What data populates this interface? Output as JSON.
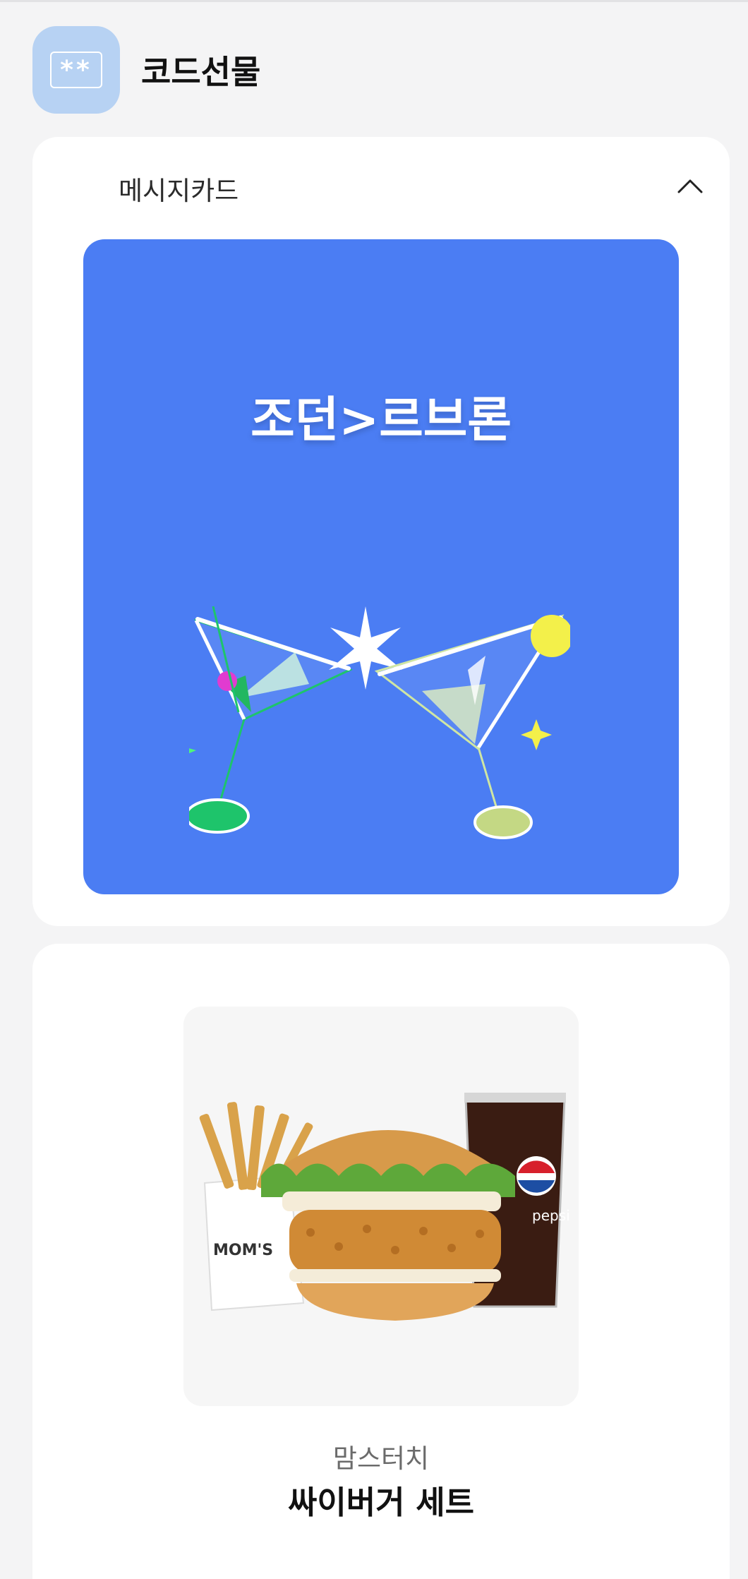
{
  "header": {
    "title": "코드선물",
    "icon_text": "**"
  },
  "message_card": {
    "section_label": "메시지카드",
    "toggle_icon": "chevron-up-icon",
    "message": "조던>르브론",
    "background_color": "#4b7df3",
    "illustration": "cocktail-toast-illustration"
  },
  "product": {
    "image": "burger-set-image",
    "brand": "맘스터치",
    "name": "싸이버거 세트",
    "image_text": {
      "fries_bag": "MOM'S",
      "cup": "pepsi"
    }
  }
}
